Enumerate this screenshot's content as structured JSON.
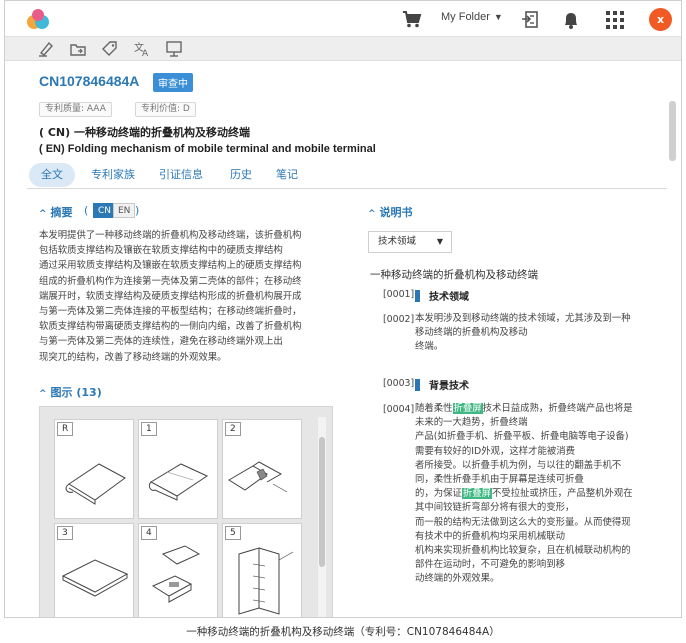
{
  "header": {
    "folder_label": "My Folder",
    "avatar_letter": "x"
  },
  "patent": {
    "number": "CN107846484A",
    "status": "审查中",
    "quality": "专利质量: AAA",
    "value": "专利价值: D",
    "title_cn": "( CN) 一种移动终端的折叠机构及移动终端",
    "title_en": "( EN) Folding mechanism of mobile terminal and mobile terminal"
  },
  "tabs": [
    {
      "label": "全文",
      "active": true
    },
    {
      "label": "专利家族"
    },
    {
      "label": "引证信息"
    },
    {
      "label": "历史"
    },
    {
      "label": "笔记"
    }
  ],
  "abstract": {
    "heading": "摘要",
    "paren_open": "(",
    "paren_close": ")",
    "lang_cn": "CN",
    "lang_en": "EN",
    "lines": [
      "本发明提供了一种移动终端的折叠机构及移动终端，该折叠机构",
      "包括软质支撑结构及镶嵌在软质支撑结构中的硬质支撑结构",
      "通过采用软质支撑结构及镶嵌在软质支撑结构上的硬质支撑结构",
      "组成的折叠机构作为连接第一壳体及第二壳体的部件；在移动终",
      "端展开时，软质支撑结构及硬质支撑结构形成的折叠机构展开成",
      "与第一壳体及第二壳体连接的平板型结构；在移动终端折叠时，",
      "软质支撑结构带离硬质支撑结构的一侧向内缩，改善了折叠机构",
      "与第一壳体及第二壳体的连续性，避免在移动终端外观上出",
      "现突兀的结构，改善了移动终端的外观效果。"
    ]
  },
  "figures": {
    "heading": "图示 (13)",
    "labels": [
      "R",
      "1",
      "2",
      "3",
      "4",
      "5"
    ]
  },
  "description": {
    "heading": "说明书",
    "select_value": "技术领域",
    "doc_title": "一种移动终端的折叠机构及移动终端",
    "p1_no": "[0001]",
    "p1_head": "技术领域",
    "p2_no": "[0002]",
    "p2_lines": [
      "本发明涉及到移动终端的技术领域，尤其涉及到一种",
      "移动终端的折叠机构及移动",
      "终端。"
    ],
    "p3_no": "[0003]",
    "p3_head": "背景技术",
    "p4_no": "[0004]",
    "p4_l1a": "随着柔性",
    "p4_hl1": "折叠屏",
    "p4_l1b": "技术日益成熟，折叠终端产品也将是",
    "p4_lines_mid": [
      "未来的一大趋势，折叠终端",
      "产品(如折叠手机、折叠平板、折叠电脑等电子设备)",
      "需要有较好的ID外观，这样才能被消费",
      "者所接受。以折叠手机为例，与以往的翻盖手机不",
      "同，柔性折叠手机由于屏幕是连续可折叠"
    ],
    "p4_l7a": "的，为保证",
    "p4_hl2": "折叠屏",
    "p4_l7b": "不受拉扯或挤压，产品整机外观在",
    "p4_lines_end": [
      "其中间铰链折弯部分将有很大的变形，",
      "而一般的结构无法做到这么大的变形量。从而使得现",
      "有技术中的折叠机构均采用机械联动",
      "机构来实现折叠机构比较复杂，且在机械联动机构的",
      "部件在运动时，不可避免的影响到移",
      "动终端的外观效果。"
    ]
  },
  "caption": "一种移动终端的折叠机构及移动终端（专利号：CN107846484A）"
}
